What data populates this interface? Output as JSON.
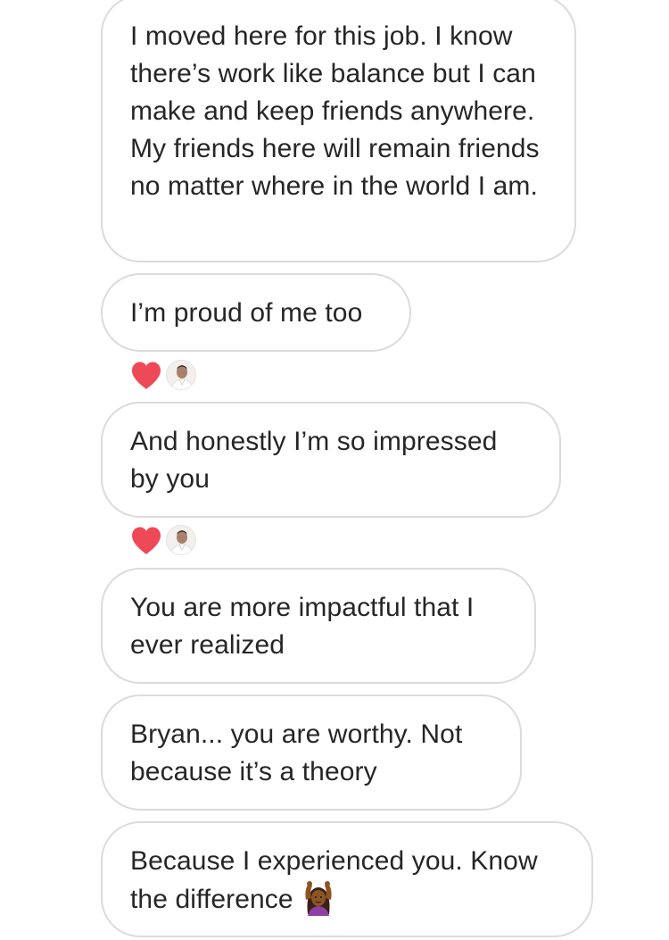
{
  "messages": [
    {
      "text": "I moved here for this job. I know there’s work like balance but I can make and keep friends anywhere. My friends here will remain friends no matter where in the world I am."
    },
    {
      "text": "I’m proud of me too",
      "reaction": "heart"
    },
    {
      "text": "And honestly I’m so impressed by you",
      "reaction": "heart"
    },
    {
      "text": "You are more impactful that I ever realized"
    },
    {
      "text": "Bryan... you are worthy. Not because it’s a theory"
    },
    {
      "text": "Because I experienced you. Know the difference",
      "emoji": "woman-gesturing-ok-emoji"
    }
  ],
  "colors": {
    "bubble_border": "#dbdbdb",
    "text": "#262626",
    "heart": "#ed4956",
    "background": "#ffffff"
  },
  "icons": {
    "reaction": "heart-icon",
    "reactor": "user-avatar"
  }
}
